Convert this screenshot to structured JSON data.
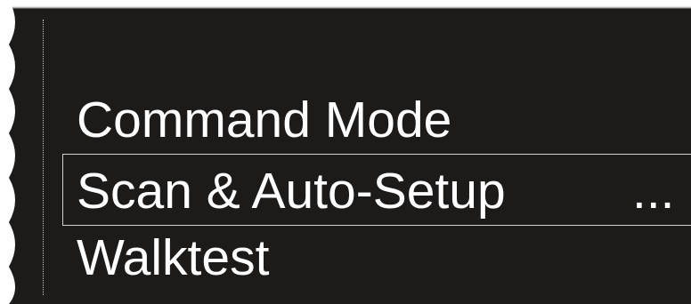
{
  "menu": {
    "items": [
      {
        "label": "Command Mode"
      },
      {
        "label": "Scan & Auto-Setup",
        "suffix": "...",
        "selected": true
      },
      {
        "label": "Walktest"
      }
    ]
  },
  "colors": {
    "background": "#1d1b1a",
    "text": "#ffffff",
    "selection_border": "#cfcfcf"
  }
}
